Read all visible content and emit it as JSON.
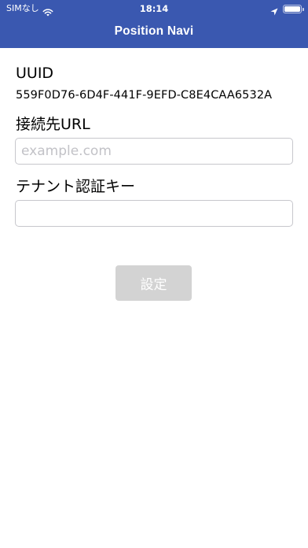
{
  "status_bar": {
    "carrier": "SIMなし",
    "time": "18:14"
  },
  "nav": {
    "title": "Position Navi"
  },
  "form": {
    "uuid_label": "UUID",
    "uuid_value": "559F0D76-6D4F-441F-9EFD-C8E4CAA6532A",
    "url_label": "接続先URL",
    "url_value": "",
    "url_placeholder": "example.com",
    "tenant_label": "テナント認証キー",
    "tenant_value": "",
    "tenant_placeholder": ""
  },
  "actions": {
    "submit_label": "設定"
  },
  "colors": {
    "header": "#3a58b0",
    "button_disabled": "#d3d3d3"
  },
  "icons": [
    "wifi-icon",
    "location-arrow-icon",
    "battery-icon"
  ]
}
